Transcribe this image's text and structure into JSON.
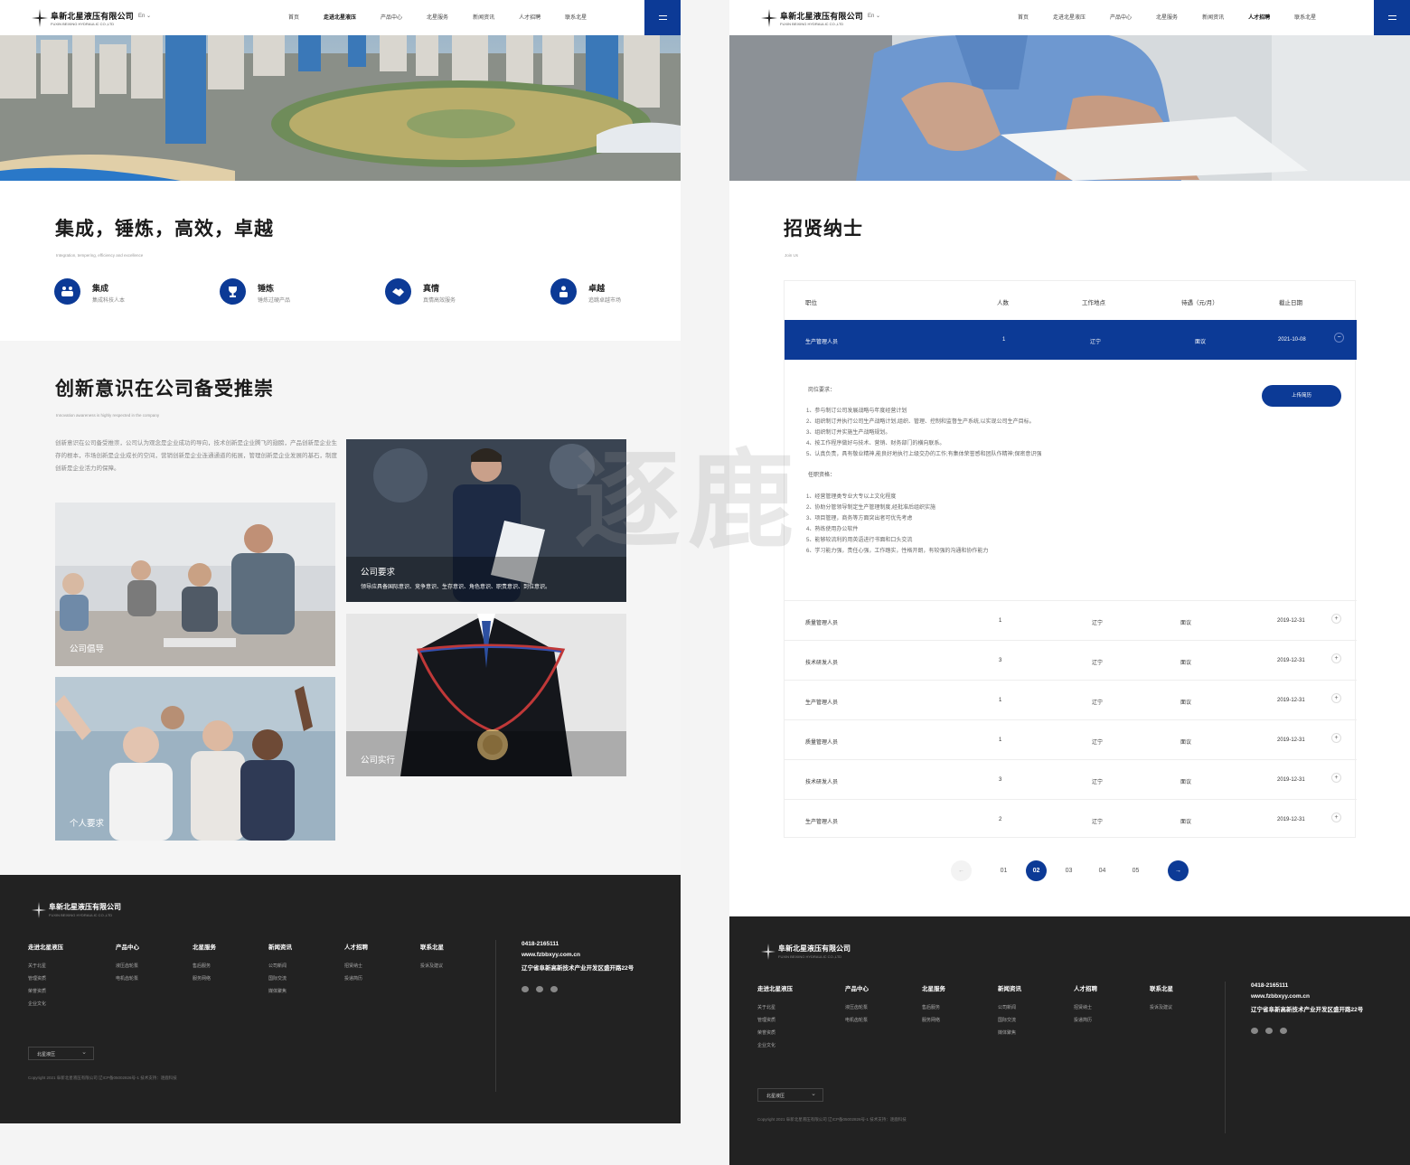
{
  "brand": {
    "name_cn": "阜新北星液压有限公司",
    "name_en": "FUXIN BEIXING HYDRAULIC CO.,LTD",
    "accent": "#0c3a96"
  },
  "header": {
    "lang": "En ⌄",
    "nav": [
      "首页",
      "走进北星液压",
      "产品中心",
      "北星服务",
      "新闻资讯",
      "人才招聘",
      "联系北星"
    ]
  },
  "left": {
    "title": "集成，锤炼，高效，卓越",
    "subtitle": "Integration, tempering, efficiency and excellence",
    "features": [
      {
        "icon": "team-icon",
        "title": "集成",
        "desc": "集成科技人本"
      },
      {
        "icon": "trophy-icon",
        "title": "锤炼",
        "desc": "锤炼过硬产品"
      },
      {
        "icon": "handshake-icon",
        "title": "真情",
        "desc": "真情高效服务"
      },
      {
        "icon": "hands-up-icon",
        "title": "卓越",
        "desc": "追跳卓越市场"
      }
    ],
    "section2_title": "创新意识在公司备受推崇",
    "section2_sub": "Innovation awareness is highly respected in the company",
    "section2_para": "创新意识在公司备受推崇，公司认为观念是企业成功的导向，技术创新是企业腾飞的翅膀，产品创新是企业生存的根本，市场创新是企业成长的空间，营销创新是企业连通通道的拓展，管理创新是企业发展的基石，制度创新是企业活力的保障。",
    "cards": [
      {
        "caption": "公司倡导"
      },
      {
        "caption": "公司要求",
        "desc": "领导应具备国际意识、竞争意识、生存意识、角色意识、职责意识、到位意识。"
      },
      {
        "caption": "个人要求"
      },
      {
        "caption": "公司实行"
      }
    ]
  },
  "right": {
    "title": "招贤纳士",
    "subtitle": "Join Us",
    "headers": [
      "职位",
      "人数",
      "工作地点",
      "待遇（元/月）",
      "截止日期"
    ],
    "active": {
      "position": "生产管理人员",
      "count": "1",
      "location": "辽宁",
      "salary": "面议",
      "date": "2021-10-08",
      "toggle": "−"
    },
    "detail": {
      "req_label": "岗位要求：",
      "reqs": [
        "1、参与制订公司发展战略与年度经营计划",
        "2、组织制订并执行公司生产战略计划,组织、管理、控制和监督生产系统,以实现公司生产目标。",
        "3、组织制订并实施生产战略规划。",
        "4、按工作程序做好与技术、营销、财务部门的横向联系。",
        "5、认真负责，具有敬业精神,能良好地执行上级交办的工作;有集体荣誉感和团队作精神;保密意识强"
      ],
      "qual_label": "任职资格：",
      "quals": [
        "1、经营管理类专业大专以上文化程度",
        "2、协助分管领导制定生产管理制度,经批准后组织实施",
        "3、项目管理，商务等方面突出者可优先考虑",
        "4、熟练使用办公软件",
        "5、能够较流利的用英语进行书面和口头交流",
        "6、学习能力强，责任心强，工作踏实，性格开朗，有较强的沟通和协作能力"
      ],
      "upload": "上传简历"
    },
    "rows": [
      {
        "position": "质量管理人员",
        "count": "1",
        "location": "辽宁",
        "salary": "面议",
        "date": "2019-12-31",
        "toggle": "+"
      },
      {
        "position": "技术研发人员",
        "count": "3",
        "location": "辽宁",
        "salary": "面议",
        "date": "2019-12-31",
        "toggle": "+"
      },
      {
        "position": "生产管理人员",
        "count": "1",
        "location": "辽宁",
        "salary": "面议",
        "date": "2019-12-31",
        "toggle": "+"
      },
      {
        "position": "质量管理人员",
        "count": "1",
        "location": "辽宁",
        "salary": "面议",
        "date": "2019-12-31",
        "toggle": "+"
      },
      {
        "position": "技术研发人员",
        "count": "3",
        "location": "辽宁",
        "salary": "面议",
        "date": "2019-12-31",
        "toggle": "+"
      },
      {
        "position": "生产管理人员",
        "count": "2",
        "location": "辽宁",
        "salary": "面议",
        "date": "2019-12-31",
        "toggle": "+"
      }
    ],
    "pager": {
      "prev": "←",
      "pages": [
        "01",
        "02",
        "03",
        "04",
        "05"
      ],
      "active": "02",
      "next": "→"
    }
  },
  "footer": {
    "cols": [
      {
        "title": "走进北星液压",
        "items": [
          "关于北星",
          "管理资质",
          "荣誉资质",
          "企业文化"
        ]
      },
      {
        "title": "产品中心",
        "items": [
          "液压齿轮泵",
          "电机齿轮泵"
        ]
      },
      {
        "title": "北星服务",
        "items": [
          "售后服务",
          "服务网络"
        ]
      },
      {
        "title": "新闻资讯",
        "items": [
          "公司新闻",
          "国际交流",
          "媒体聚焦"
        ]
      },
      {
        "title": "人才招聘",
        "items": [
          "招贤纳士",
          "投递简历"
        ]
      },
      {
        "title": "联系北星",
        "items": [
          "投诉及建议"
        ]
      }
    ],
    "phone": "0418-2165111",
    "site": "www.fzbbxyy.com.cn",
    "address": "辽宁省阜新高新技术产业开发区盛开路22号",
    "select": "北星液压",
    "copyright": "Copyright 2021 阜新北星液压有限公司 辽ICP备05002826号-1 技术支持：逐鹿科技"
  },
  "watermark": "逐鹿"
}
